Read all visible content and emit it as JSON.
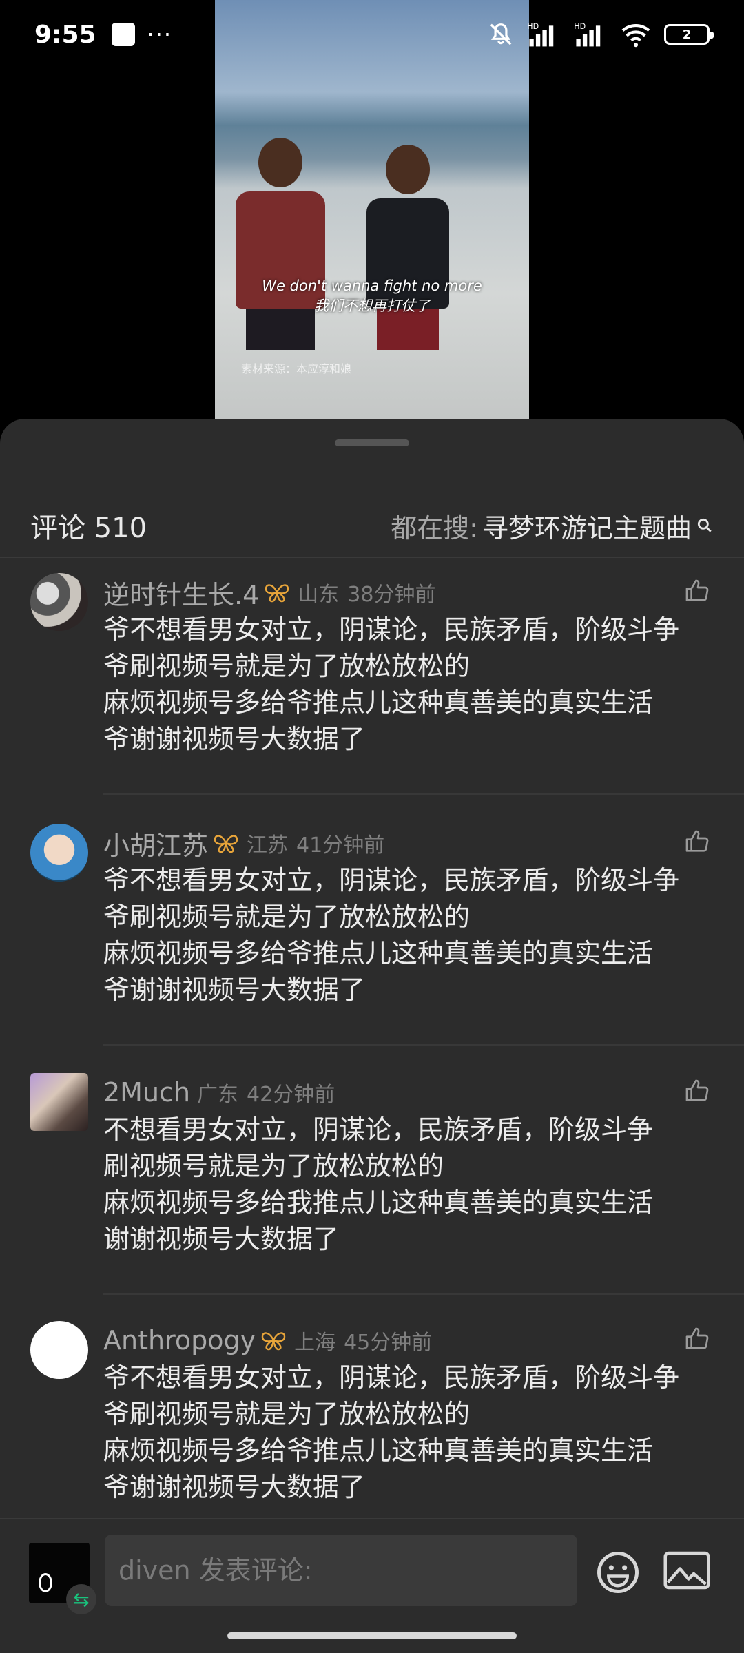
{
  "status_bar": {
    "time": "9:55",
    "dots": "···",
    "battery": "2"
  },
  "video": {
    "subtitle_en": "We don't wanna fight no more",
    "subtitle_cn": "我们不想再打仗了",
    "watermark": "素材来源：本应淳和娘"
  },
  "comments_header": {
    "title": "评论 510",
    "search_prefix": "都在搜:",
    "search_term": "寻梦环游记主题曲"
  },
  "comments": [
    {
      "username": "逆时针生长.4",
      "has_badge": true,
      "region": "山东",
      "time": "38分钟前",
      "text": "爷不想看男女对立，阴谋论，民族矛盾，阶级斗争\n爷刷视频号就是为了放松放松的\n麻烦视频号多给爷推点儿这种真善美的真实生活\n爷谢谢视频号大数据了"
    },
    {
      "username": "小胡江苏",
      "has_badge": true,
      "region": "江苏",
      "time": "41分钟前",
      "text": "爷不想看男女对立，阴谋论，民族矛盾，阶级斗争\n爷刷视频号就是为了放松放松的\n麻烦视频号多给爷推点儿这种真善美的真实生活\n爷谢谢视频号大数据了"
    },
    {
      "username": "2Much",
      "has_badge": false,
      "region": "广东",
      "time": "42分钟前",
      "text": "不想看男女对立，阴谋论，民族矛盾，阶级斗争\n刷视频号就是为了放松放松的\n麻烦视频号多给我推点儿这种真善美的真实生活\n谢谢视频号大数据了"
    },
    {
      "username": "Anthropogy",
      "has_badge": true,
      "region": "上海",
      "time": "45分钟前",
      "text": "爷不想看男女对立，阴谋论，民族矛盾，阶级斗争\n爷刷视频号就是为了放松放松的\n麻烦视频号多给爷推点儿这种真善美的真实生活\n爷谢谢视频号大数据了"
    }
  ],
  "input_bar": {
    "placeholder": "diven 发表评论:",
    "swap_glyph": "⇆"
  },
  "colors": {
    "sheet_bg": "#2c2c2c",
    "badge": "#e8a53a",
    "accent_green": "#19c37d"
  }
}
